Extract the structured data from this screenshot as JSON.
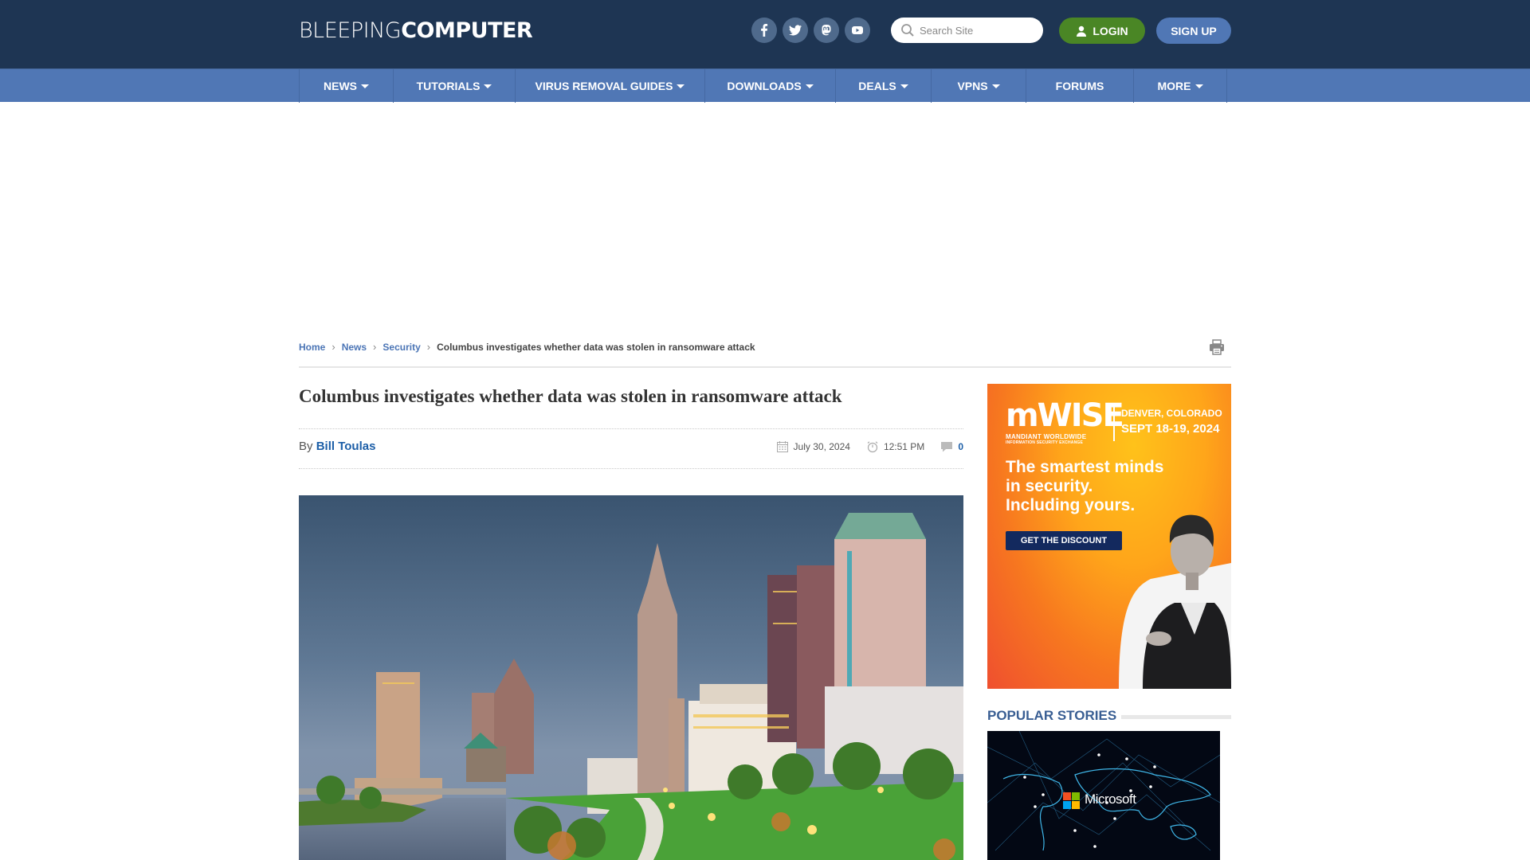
{
  "header": {
    "logo_light": "BLEEPING",
    "logo_bold": "COMPUTER",
    "social": [
      {
        "name": "facebook-icon",
        "label": "Facebook"
      },
      {
        "name": "twitter-icon",
        "label": "Twitter"
      },
      {
        "name": "mastodon-icon",
        "label": "Mastodon"
      },
      {
        "name": "youtube-icon",
        "label": "YouTube"
      }
    ],
    "search_placeholder": "Search Site",
    "login_label": "LOGIN",
    "signup_label": "SIGN UP"
  },
  "nav": {
    "items": [
      {
        "label": "NEWS",
        "dropdown": true
      },
      {
        "label": "TUTORIALS",
        "dropdown": true
      },
      {
        "label": "VIRUS REMOVAL GUIDES",
        "dropdown": true
      },
      {
        "label": "DOWNLOADS",
        "dropdown": true
      },
      {
        "label": "DEALS",
        "dropdown": true
      },
      {
        "label": "VPNS",
        "dropdown": true
      },
      {
        "label": "FORUMS",
        "dropdown": false
      },
      {
        "label": "MORE",
        "dropdown": true
      }
    ]
  },
  "breadcrumb": {
    "items": [
      "Home",
      "News",
      "Security"
    ],
    "current": "Columbus investigates whether data was stolen in ransomware attack"
  },
  "article": {
    "title": "Columbus investigates whether data was stolen in ransomware attack",
    "by_label": "By",
    "author": "Bill Toulas",
    "date": "July 30, 2024",
    "time": "12:51 PM",
    "comments": "0"
  },
  "ad": {
    "brand": "mWISE",
    "brand_sub1": "MANDIANT WORLDWIDE",
    "brand_sub2": "INFORMATION SECURITY EXCHANGE",
    "location": "DENVER, COLORADO",
    "dates": "SEPT 18-19, 2024",
    "tagline_1": "The smartest minds",
    "tagline_2": "in security.",
    "tagline_3": "Including yours.",
    "cta": "GET THE DISCOUNT"
  },
  "sidebar": {
    "popular_title": "POPULAR STORIES",
    "popular_image_caption": "Microsoft"
  }
}
